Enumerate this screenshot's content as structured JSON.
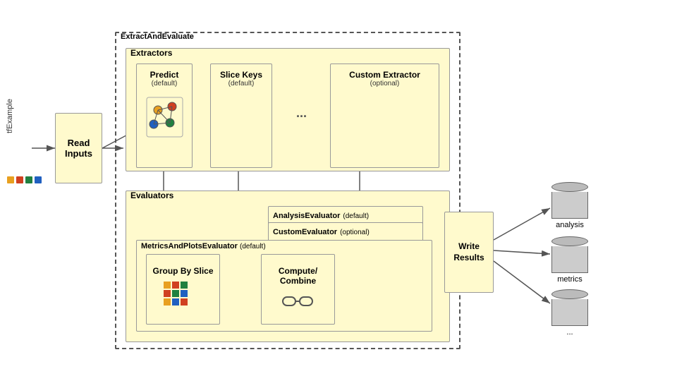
{
  "diagram": {
    "title": "ExtractAndEvaluate",
    "sections": {
      "extractors": {
        "label": "Extractors",
        "predict": {
          "label": "Predict",
          "sublabel": "(default)"
        },
        "sliceKeys": {
          "label": "Slice Keys",
          "sublabel": "(default)"
        },
        "customExtractor": {
          "label": "Custom Extractor",
          "sublabel": "(optional)"
        },
        "ellipsis": "..."
      },
      "evaluators": {
        "label": "Evaluators",
        "analysisEvaluator": {
          "label": "AnalysisEvaluator",
          "sublabel": "(default)"
        },
        "customEvaluator": {
          "label": "CustomEvaluator",
          "sublabel": "(optional)"
        },
        "metricsAndPlots": {
          "label": "MetricsAndPlotsEvaluator",
          "sublabel": "(default)",
          "groupBySlice": {
            "label": "Group By Slice"
          },
          "computeCombine": {
            "label": "Compute/ Combine"
          }
        }
      }
    },
    "readInputs": {
      "label": "Read Inputs",
      "inputLabel": "tfExample"
    },
    "writeResults": {
      "label": "Write Results"
    },
    "outputs": {
      "analysis": "analysis",
      "metrics": "metrics",
      "ellipsis": "..."
    }
  }
}
